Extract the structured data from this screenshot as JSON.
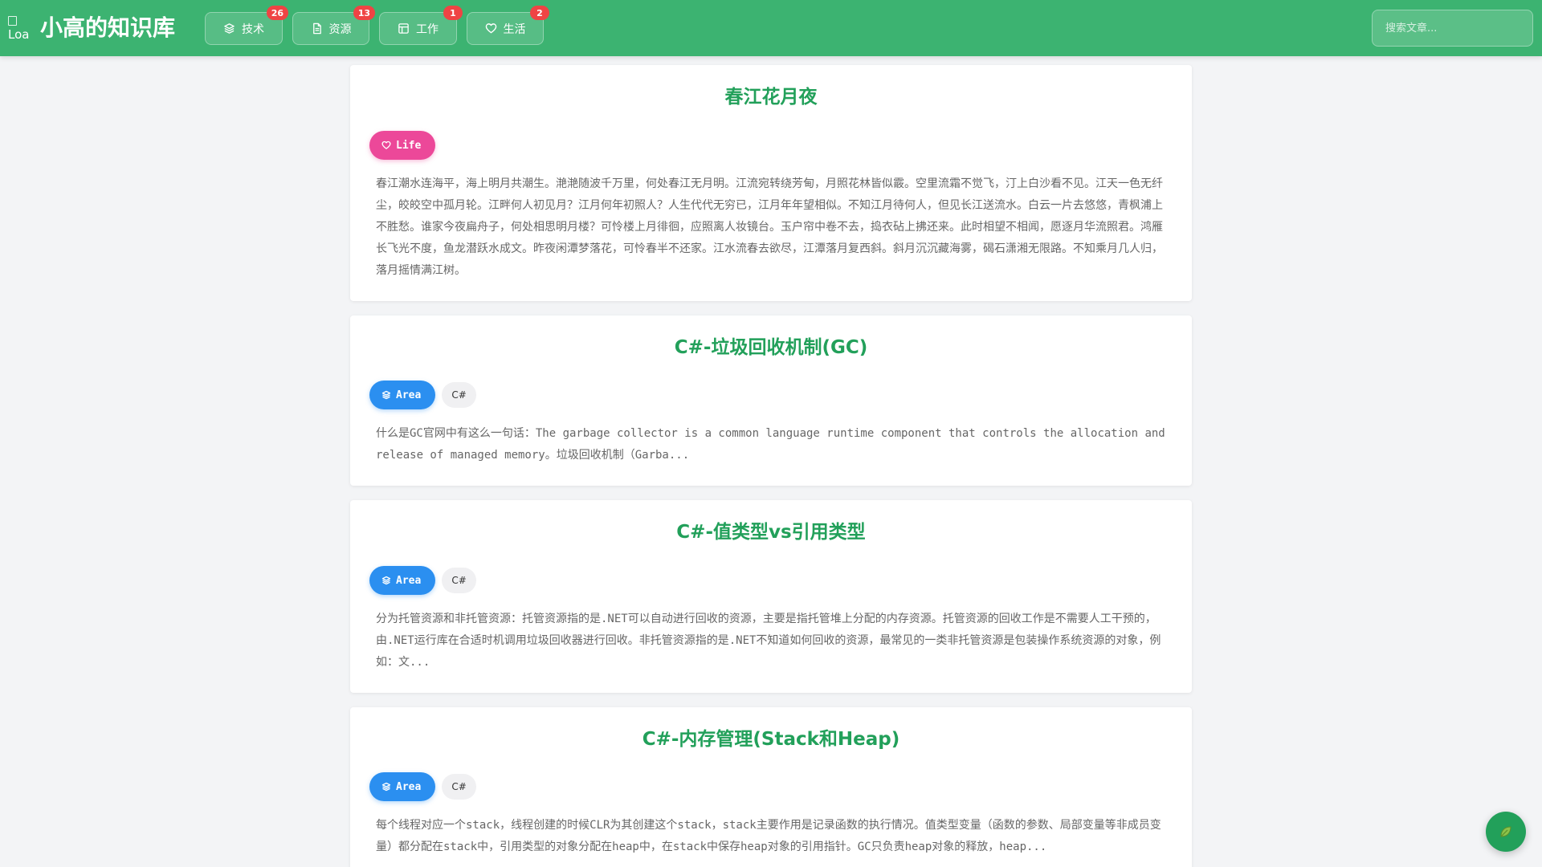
{
  "header": {
    "logo_alt": "Loa",
    "title": "小高的知识库",
    "nav": [
      {
        "label": "技术",
        "count": "26",
        "icon": "layers-icon"
      },
      {
        "label": "资源",
        "count": "13",
        "icon": "document-icon"
      },
      {
        "label": "工作",
        "count": "1",
        "icon": "layout-icon"
      },
      {
        "label": "生活",
        "count": "2",
        "icon": "heart-icon"
      }
    ],
    "search_placeholder": "搜索文章..."
  },
  "posts": [
    {
      "title": "春江花月夜",
      "category": "Life",
      "category_icon": "heart-icon",
      "category_color": "#ec4899",
      "tag": "",
      "excerpt": "春江潮水连海平，海上明月共潮生。滟滟随波千万里，何处春江无月明。江流宛转绕芳甸，月照花林皆似霰。空里流霜不觉飞，汀上白沙看不见。江天一色无纤尘，皎皎空中孤月轮。江畔何人初见月？江月何年初照人？人生代代无穷已，江月年年望相似。不知江月待何人，但见长江送流水。白云一片去悠悠，青枫浦上不胜愁。谁家今夜扁舟子，何处相思明月楼？可怜楼上月徘徊，应照离人妆镜台。玉户帘中卷不去，捣衣砧上拂还来。此时相望不相闻，愿逐月华流照君。鸿雁长飞光不度，鱼龙潜跃水成文。昨夜闲潭梦落花，可怜春半不还家。江水流春去欲尽，江潭落月复西斜。斜月沉沉藏海雾，碣石潇湘无限路。不知乘月几人归，落月摇情满江树。"
    },
    {
      "title": "C#-垃圾回收机制(GC)",
      "category": "Area",
      "category_icon": "layers-icon",
      "category_color": "#2b8ff0",
      "tag": "C#",
      "excerpt": "什么是GC官网中有这么一句话：The garbage collector is a common language runtime component that controls the allocation and release of managed memory。垃圾回收机制（Garba..."
    },
    {
      "title": "C#-值类型vs引用类型",
      "category": "Area",
      "category_icon": "layers-icon",
      "category_color": "#2b8ff0",
      "tag": "C#",
      "excerpt": "分为托管资源和非托管资源：托管资源指的是.NET可以自动进行回收的资源，主要是指托管堆上分配的内存资源。托管资源的回收工作是不需要人工干预的，由.NET运行库在合适时机调用垃圾回收器进行回收。非托管资源指的是.NET不知道如何回收的资源，最常见的一类非托管资源是包装操作系统资源的对象，例如：文..."
    },
    {
      "title": "C#-内存管理(Stack和Heap)",
      "category": "Area",
      "category_icon": "layers-icon",
      "category_color": "#2b8ff0",
      "tag": "C#",
      "excerpt": "每个线程对应一个stack，线程创建的时候CLR为其创建这个stack，stack主要作用是记录函数的执行情况。值类型变量（函数的参数、局部变量等非成员变量）都分配在stack中，引用类型的对象分配在heap中，在stack中保存heap对象的引用指针。GC只负责heap对象的释放，heap..."
    }
  ],
  "fab": {
    "icon": "leaf-icon",
    "color": "#22a05a"
  },
  "colors": {
    "header_bg": "#3cb371",
    "title_green": "#22a05a",
    "badge_red": "#ef4444"
  }
}
